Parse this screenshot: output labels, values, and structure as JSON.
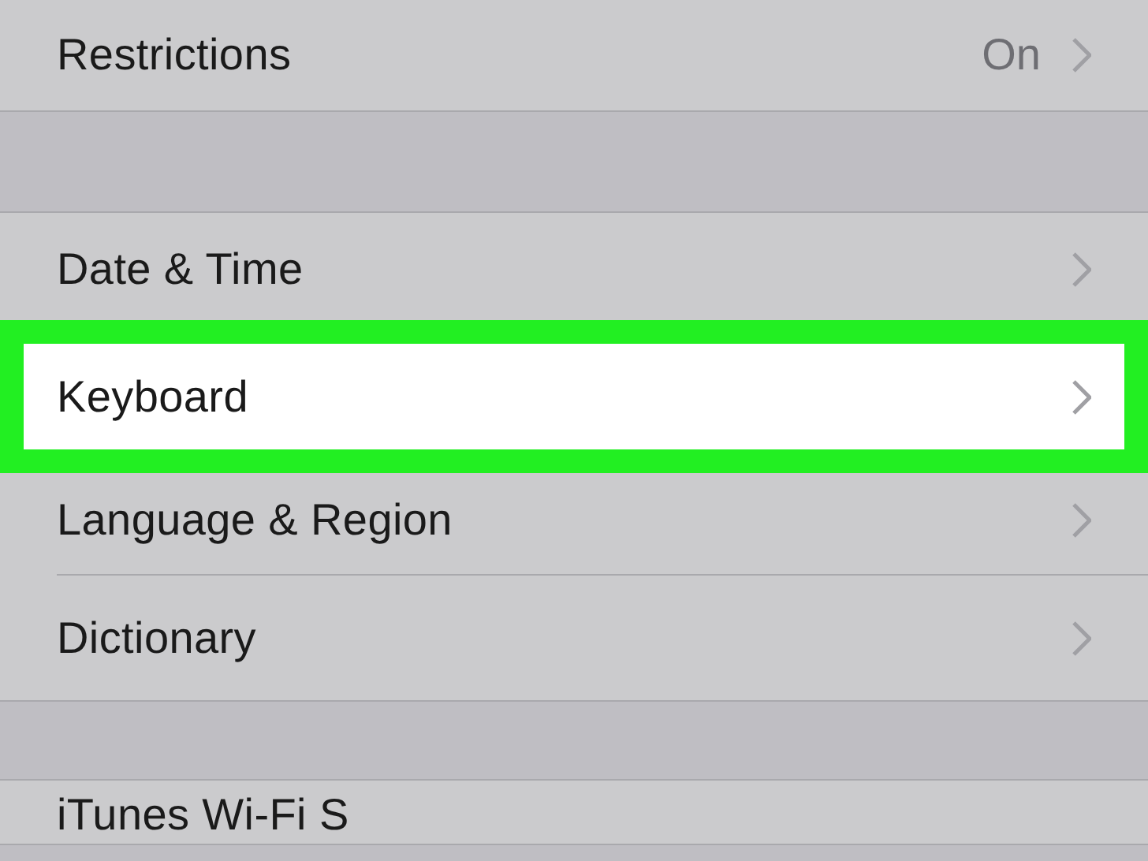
{
  "groups": [
    {
      "rows": [
        {
          "label": "Restrictions",
          "value": "On",
          "chevron": true,
          "highlighted": false
        }
      ]
    },
    {
      "rows": [
        {
          "label": "Date & Time",
          "chevron": true,
          "highlighted": false
        },
        {
          "label": "Keyboard",
          "chevron": true,
          "highlighted": true
        },
        {
          "label": "Language & Region",
          "chevron": true,
          "highlighted": false
        },
        {
          "label": "Dictionary",
          "chevron": true,
          "highlighted": false
        }
      ]
    },
    {
      "rows": [
        {
          "label": "iTunes Wi-Fi S",
          "highlighted": false
        }
      ]
    }
  ]
}
